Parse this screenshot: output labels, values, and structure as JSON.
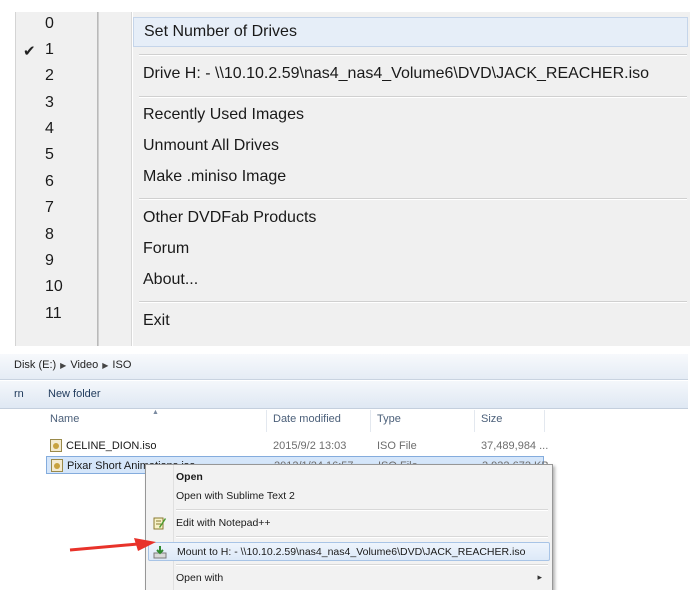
{
  "number_menu": {
    "items": [
      {
        "label": "0",
        "checked": false
      },
      {
        "label": "1",
        "checked": true
      },
      {
        "label": "2",
        "checked": false
      },
      {
        "label": "3",
        "checked": false
      },
      {
        "label": "4",
        "checked": false
      },
      {
        "label": "5",
        "checked": false
      },
      {
        "label": "6",
        "checked": false
      },
      {
        "label": "7",
        "checked": false
      },
      {
        "label": "8",
        "checked": false
      },
      {
        "label": "9",
        "checked": false
      },
      {
        "label": "10",
        "checked": false
      },
      {
        "label": "11",
        "checked": false
      }
    ],
    "check_glyph": "✔"
  },
  "context_menu": {
    "set_number": "Set Number of Drives",
    "drive_h": "Drive H: - \\\\10.10.2.59\\nas4_nas4_Volume6\\DVD\\JACK_REACHER.iso",
    "recently_used": "Recently Used Images",
    "unmount_all": "Unmount All Drives",
    "make_miniso": "Make .miniso Image",
    "other_products": "Other DVDFab Products",
    "forum": "Forum",
    "about": "About...",
    "exit": "Exit"
  },
  "explorer": {
    "breadcrumb": [
      "Disk (E:)",
      "Video",
      "ISO"
    ],
    "toolbar": {
      "organize": "rn",
      "new_folder": "New folder"
    },
    "columns": {
      "name": "Name",
      "date": "Date modified",
      "type": "Type",
      "size": "Size"
    },
    "files": [
      {
        "name": "CELINE_DION.iso",
        "date": "2015/9/2 13:03",
        "type": "ISO File",
        "size": "37,489,984 ..."
      },
      {
        "name": "Pixar Short Animations.iso",
        "date": "2012/1/24 16:57",
        "type": "ISO File",
        "size": "3,932,672 KB"
      }
    ],
    "file_menu": {
      "open": "Open",
      "open_sublime": "Open with Sublime Text 2",
      "edit_notepad": "Edit with Notepad++",
      "mount": "Mount to H: - \\\\10.10.2.59\\nas4_nas4_Volume6\\DVD\\JACK_REACHER.iso",
      "open_with": "Open with",
      "submenu_arrow": "▸"
    }
  },
  "colors": {
    "highlight": "#e6eef8",
    "annotation_arrow": "#e8322a",
    "selection": "#d5e6fa"
  }
}
